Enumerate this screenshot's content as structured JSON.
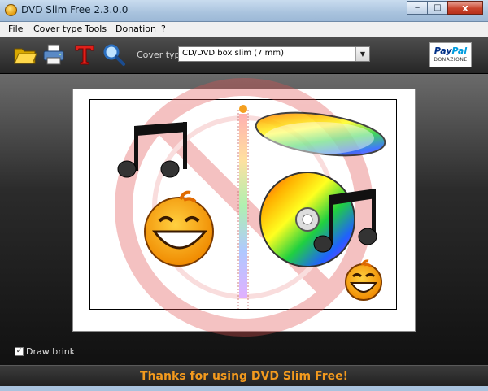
{
  "window": {
    "title": "DVD Slim Free 2.3.0.0",
    "min": "‒",
    "max": "□",
    "close": "x"
  },
  "menu": [
    {
      "label": "File"
    },
    {
      "label": "Cover type"
    },
    {
      "label": "Tools"
    },
    {
      "label": "Donation"
    },
    {
      "label": "?"
    }
  ],
  "toolbar": {
    "icons": [
      "open-folder-icon",
      "print-icon",
      "text-icon",
      "zoom-icon"
    ],
    "cover_type_label": "Cover type",
    "cover_type_value": "CD/DVD box slim (7 mm)"
  },
  "paypal": {
    "brand_left": "Pay",
    "brand_right": "Pal",
    "caption": "DONAZIONE"
  },
  "options": {
    "draw_brink_label": "Draw brink",
    "draw_brink_checked": "✓"
  },
  "footer": {
    "message": "Thanks for using DVD Slim Free!"
  },
  "colors": {
    "accent": "#f39a1e",
    "toolbar": "#3a3a3a",
    "titlebar": "#b6cde6",
    "close": "#c9452d"
  }
}
